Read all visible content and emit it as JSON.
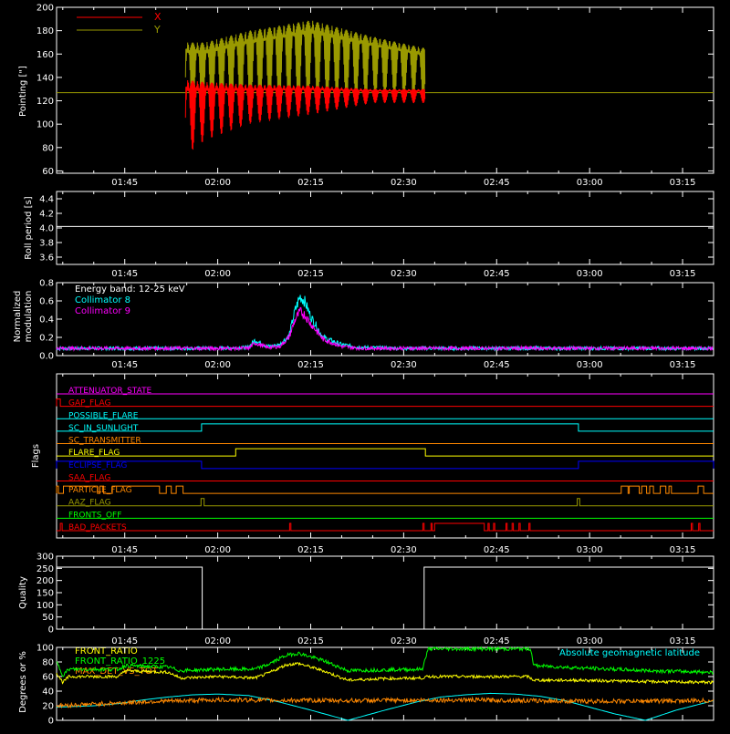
{
  "time_axis": {
    "tick_labels": [
      "01:45",
      "02:00",
      "02:15",
      "02:30",
      "02:45",
      "03:00",
      "03:15"
    ],
    "tick_minutes": [
      105,
      120,
      135,
      150,
      165,
      180,
      195
    ],
    "range_minutes": [
      94,
      200
    ],
    "minor_step_minutes": 5
  },
  "colors": {
    "background": "#000000",
    "axes": "#ffffff",
    "red": "#ff0000",
    "olive": "#999900",
    "cyan": "#00ffff",
    "magenta": "#ff00ff",
    "yellow": "#ffff00",
    "green": "#00ff00",
    "orange": "#ff8800",
    "blue": "#0000ff"
  },
  "chart_data": [
    {
      "id": "pointing",
      "type": "line",
      "ylabel": "Pointing [\"]",
      "ylim": [
        58,
        200
      ],
      "yticks": [
        60,
        80,
        100,
        120,
        140,
        160,
        180,
        200
      ],
      "legend": [
        {
          "name": "X",
          "color": "#ff0000"
        },
        {
          "name": "Y",
          "color": "#999900"
        }
      ],
      "reference_line": 127,
      "x_start_minutes": 114.8,
      "x_end_minutes": 153.5,
      "series": [
        {
          "name": "X",
          "color": "#ff0000",
          "x_minutes": [
            114.8,
            118,
            125,
            135,
            145,
            153.5
          ],
          "upper": [
            138,
            136,
            134,
            133,
            130,
            130
          ],
          "lower": [
            73,
            86,
            100,
            108,
            118,
            118
          ]
        },
        {
          "name": "Y",
          "color": "#999900",
          "x_minutes": [
            114.8,
            118,
            125,
            135,
            145,
            153.5
          ],
          "upper": [
            170,
            170,
            180,
            189,
            175,
            165
          ],
          "lower": [
            110,
            105,
            106,
            113,
            120,
            122
          ]
        }
      ]
    },
    {
      "id": "roll",
      "type": "line",
      "ylabel": "Roll period [s]",
      "ylim": [
        3.5,
        4.5
      ],
      "yticks": [
        3.6,
        3.8,
        4.0,
        4.2,
        4.4
      ],
      "series": [
        {
          "name": "",
          "color": "#ffffff",
          "x_minutes": [
            94,
            200
          ],
          "values": [
            4.02,
            4.02
          ]
        }
      ]
    },
    {
      "id": "modulation",
      "type": "line",
      "ylabel": [
        "Normalized",
        "modulation"
      ],
      "ylim": [
        0.0,
        0.8
      ],
      "yticks": [
        0.0,
        0.2,
        0.4,
        0.6,
        0.8
      ],
      "legend_title": "Energy band: 12-25 keV",
      "series": [
        {
          "name": "Collimator 8",
          "color": "#00ffff",
          "x_minutes": [
            94,
            120,
            125,
            126,
            128,
            130,
            131.5,
            132.5,
            133.3,
            134,
            135,
            137,
            140,
            143,
            150,
            160,
            200
          ],
          "values": [
            0.08,
            0.08,
            0.09,
            0.17,
            0.1,
            0.12,
            0.22,
            0.5,
            0.65,
            0.6,
            0.43,
            0.2,
            0.12,
            0.09,
            0.08,
            0.08,
            0.08
          ]
        },
        {
          "name": "Collimator 9",
          "color": "#ff00ff",
          "x_minutes": [
            94,
            120,
            125,
            126,
            128,
            130,
            131.5,
            132.5,
            133.3,
            134,
            135,
            137,
            140,
            143,
            150,
            160,
            200
          ],
          "values": [
            0.08,
            0.08,
            0.08,
            0.14,
            0.09,
            0.1,
            0.2,
            0.4,
            0.48,
            0.45,
            0.35,
            0.18,
            0.1,
            0.08,
            0.08,
            0.08,
            0.08
          ]
        }
      ]
    },
    {
      "id": "flags",
      "type": "line",
      "ylabel": "Flags",
      "rows": [
        {
          "label": "ATTENUATOR_STATE",
          "color": "#ff00ff",
          "on_intervals": []
        },
        {
          "label": "GAP_FLAG",
          "color": "#ff0000",
          "on_intervals": [
            [
              94,
              94.6
            ]
          ]
        },
        {
          "label": "POSSIBLE_FLARE",
          "color": "#00ffff",
          "on_intervals": []
        },
        {
          "label": "SC_IN_SUNLIGHT",
          "color": "#00ffff",
          "on_intervals": [
            [
              117.4,
              178.2
            ]
          ]
        },
        {
          "label": "SC_TRANSMITTER",
          "color": "#ff8800",
          "on_intervals": []
        },
        {
          "label": "FLARE_FLAG",
          "color": "#ffff00",
          "on_intervals": [
            [
              122.9,
              153.5
            ]
          ]
        },
        {
          "label": "ECLIPSE_FLAG",
          "color": "#0000ff",
          "on_intervals": [
            [
              94,
              117.4
            ],
            [
              178.2,
              200
            ]
          ]
        },
        {
          "label": "SAA_FLAG",
          "color": "#ff0000",
          "on_intervals": []
        },
        {
          "label": "PARTICLE_FLAG",
          "color": "#ff8800",
          "on_intervals": [
            [
              94,
              94.3
            ],
            [
              95.1,
              100.6
            ],
            [
              101,
              101.6
            ],
            [
              103,
              110.6
            ],
            [
              111.7,
              112.5
            ],
            [
              113.3,
              114.4
            ],
            [
              185.1,
              186.2
            ],
            [
              186.4,
              188
            ],
            [
              188.4,
              189.2
            ],
            [
              189.7,
              190.3
            ],
            [
              191.4,
              192.3
            ],
            [
              192.8,
              193.2
            ],
            [
              197.5,
              198.4
            ]
          ]
        },
        {
          "label": "AAZ_FLAG",
          "color": "#999900",
          "on_intervals": [
            [
              117.3,
              117.8
            ],
            [
              178,
              178.4
            ]
          ]
        },
        {
          "label": "FRONTS_OFF",
          "color": "#00ff00",
          "on_intervals": []
        },
        {
          "label": "BAD_PACKETS",
          "color": "#ff0000",
          "on_intervals": [
            [
              94.6,
              94.9
            ],
            [
              131.6,
              131.8
            ],
            [
              153.1,
              153.3
            ],
            [
              154.4,
              154.6
            ],
            [
              155,
              163
            ],
            [
              163.6,
              163.8
            ],
            [
              164.5,
              164.7
            ],
            [
              166.5,
              166.7
            ],
            [
              167.5,
              167.7
            ],
            [
              168.6,
              168.8
            ],
            [
              170.2,
              170.4
            ],
            [
              196.4,
              196.6
            ],
            [
              197.6,
              197.8
            ]
          ]
        }
      ]
    },
    {
      "id": "quality",
      "type": "line",
      "ylabel": "Quality",
      "ylim": [
        0,
        300
      ],
      "yticks": [
        0,
        50,
        100,
        150,
        200,
        250,
        300
      ],
      "series": [
        {
          "name": "",
          "color": "#ffffff",
          "x_minutes": [
            94,
            117.5,
            117.5,
            153.3,
            153.3,
            200
          ],
          "values": [
            255,
            255,
            0,
            0,
            255,
            255
          ]
        }
      ]
    },
    {
      "id": "ratios",
      "type": "line",
      "ylabel": "Degrees or %",
      "ylim": [
        0,
        100
      ],
      "yticks": [
        0,
        20,
        40,
        60,
        80,
        100
      ],
      "legend": [
        {
          "name": "FRONT_RATIO",
          "color": "#ffff00"
        },
        {
          "name": "FRONT_RATIO_1225",
          "color": "#00ff00"
        },
        {
          "name": "MAX_DET_VS_TOT",
          "color": "#ff8800"
        }
      ],
      "annotation": {
        "text": "Absolute geomagnetic latitude",
        "color": "#00ffff"
      },
      "series": [
        {
          "name": "FRONT_RATIO",
          "color": "#ffff00",
          "x_minutes": [
            94,
            95,
            96,
            104,
            105,
            112,
            114,
            120,
            126,
            128,
            131,
            133,
            137,
            141,
            146,
            153,
            154,
            158,
            170,
            171,
            178,
            190,
            200
          ],
          "values": [
            65,
            52,
            60,
            60,
            68,
            66,
            58,
            60,
            58,
            64,
            76,
            78,
            68,
            55,
            57,
            58,
            60,
            60,
            60,
            55,
            55,
            53,
            52
          ]
        },
        {
          "name": "FRONT_RATIO_1225",
          "color": "#00ff00",
          "x_minutes": [
            94,
            95,
            96,
            104,
            105,
            112,
            114,
            120,
            126,
            128,
            131,
            133,
            137,
            141,
            146,
            153,
            153.4,
            154,
            160,
            170.5,
            171,
            178,
            190,
            200
          ],
          "values": [
            80,
            62,
            70,
            70,
            75,
            73,
            68,
            70,
            70,
            76,
            89,
            92,
            82,
            68,
            69,
            70,
            82,
            98,
            98,
            98,
            75,
            72,
            68,
            66
          ]
        },
        {
          "name": "MAX_DET_VS_TOT",
          "color": "#ff8800",
          "x_minutes": [
            94,
            110,
            120,
            140,
            160,
            180,
            200
          ],
          "values": [
            20,
            26,
            28,
            27,
            28,
            26,
            27
          ]
        }
      ],
      "latitude_curve": {
        "name": "Absolute geomagnetic latitude",
        "color": "#00ffff",
        "x_minutes": [
          94,
          100,
          104,
          108,
          112,
          116,
          120,
          125,
          130,
          135,
          141,
          147,
          152,
          156,
          160,
          164,
          168,
          172,
          176,
          180,
          184,
          189,
          194,
          200
        ],
        "values": [
          18,
          20,
          23,
          28,
          32,
          35,
          36,
          34,
          25,
          14,
          0,
          14,
          25,
          32,
          35,
          37,
          36,
          33,
          27,
          18,
          9,
          0,
          14,
          27
        ]
      }
    }
  ]
}
